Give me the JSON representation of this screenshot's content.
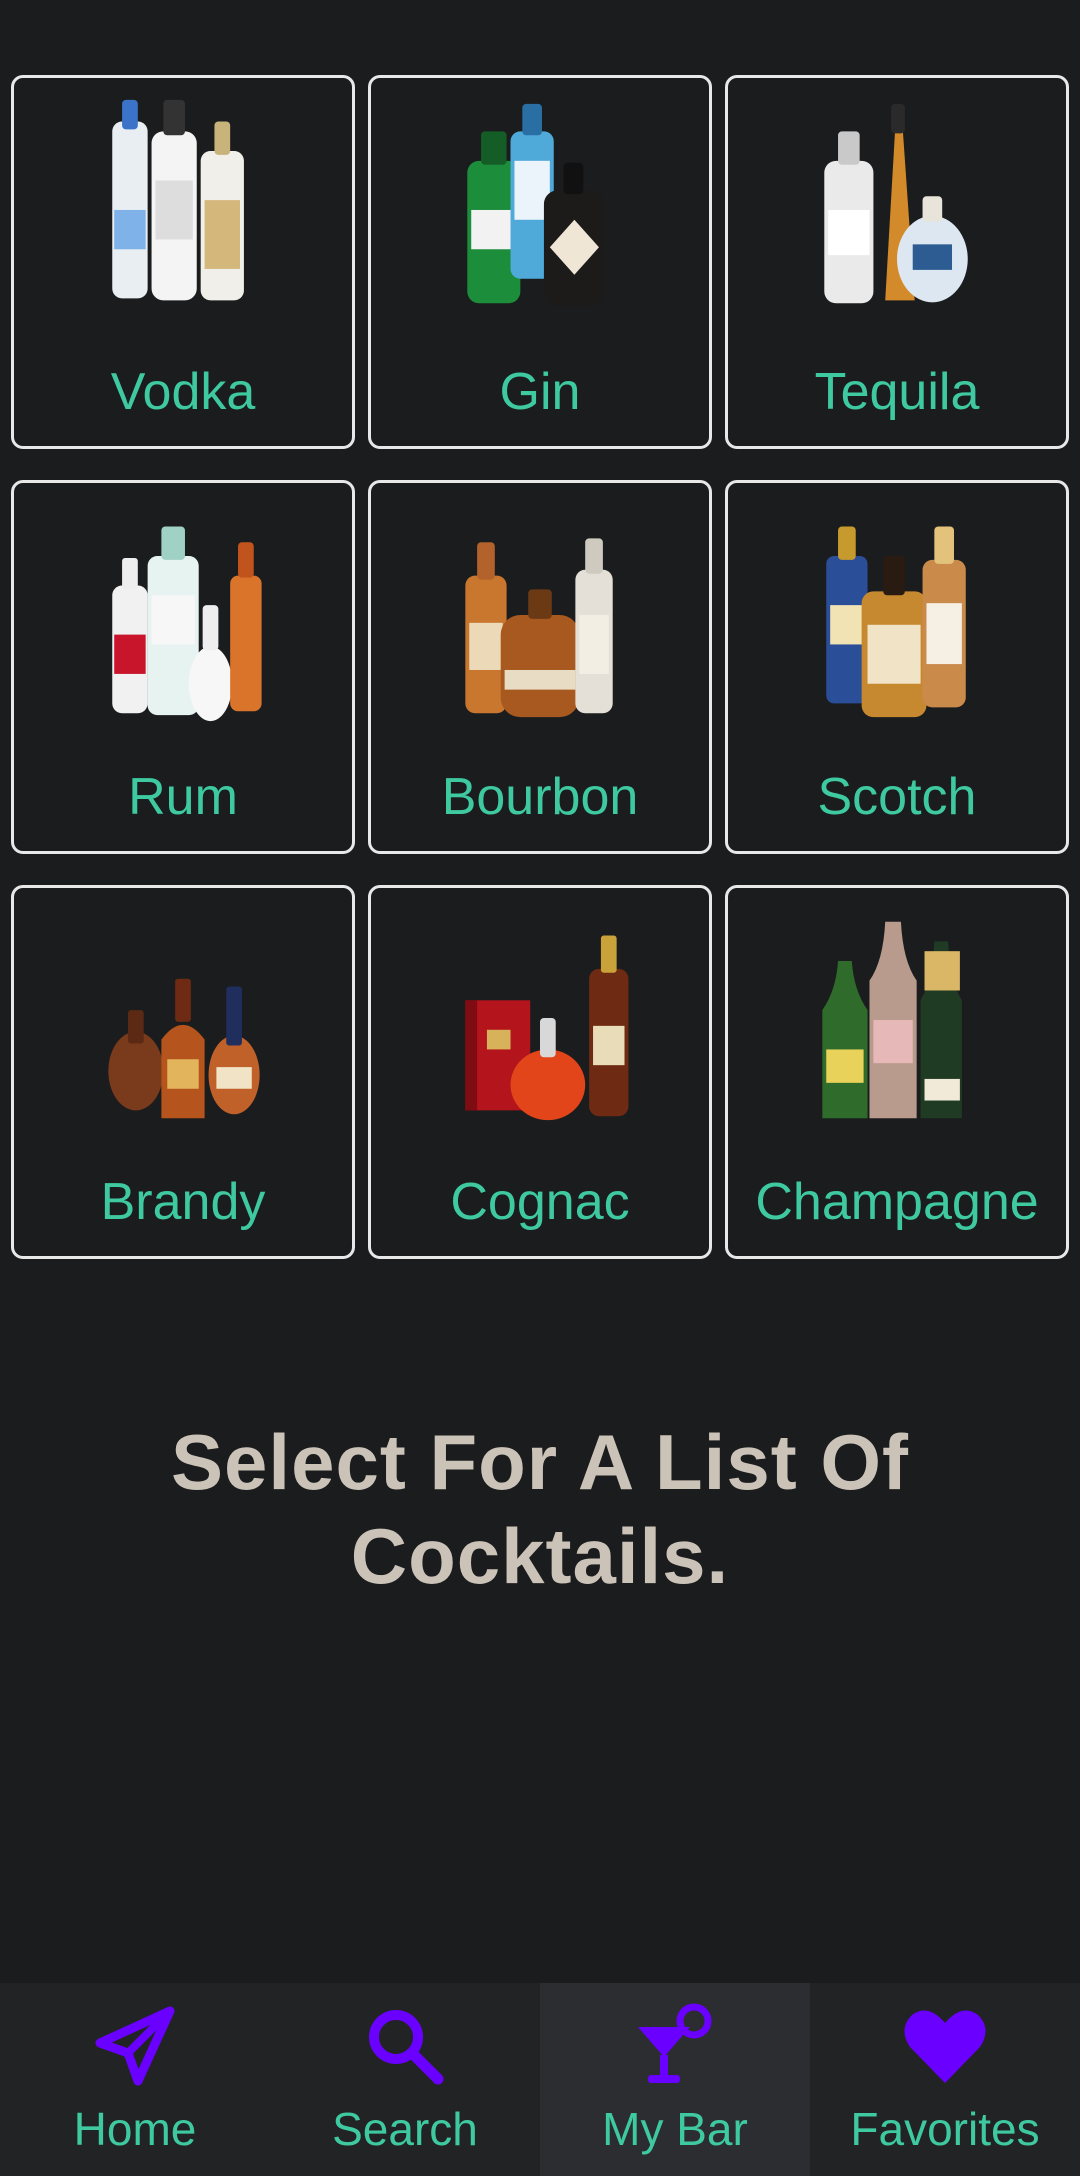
{
  "colors": {
    "background": "#1b1c1e",
    "accent_text": "#3ec9a0",
    "nav_icon": "#6a00ff",
    "prompt_text": "#cbc3b8",
    "tile_border": "#e8e8e8"
  },
  "spirits": [
    {
      "label": "Vodka",
      "icon": "vodka-bottles-image"
    },
    {
      "label": "Gin",
      "icon": "gin-bottles-image"
    },
    {
      "label": "Tequila",
      "icon": "tequila-bottles-image"
    },
    {
      "label": "Rum",
      "icon": "rum-bottles-image"
    },
    {
      "label": "Bourbon",
      "icon": "bourbon-bottles-image"
    },
    {
      "label": "Scotch",
      "icon": "scotch-bottles-image"
    },
    {
      "label": "Brandy",
      "icon": "brandy-bottles-image"
    },
    {
      "label": "Cognac",
      "icon": "cognac-bottles-image"
    },
    {
      "label": "Champagne",
      "icon": "champagne-bottles-image"
    }
  ],
  "prompt": {
    "line1": "Select For A List Of",
    "line2": "Cocktails."
  },
  "nav": {
    "items": [
      {
        "label": "Home",
        "icon": "paper-plane-icon",
        "active": false
      },
      {
        "label": "Search",
        "icon": "search-icon",
        "active": false
      },
      {
        "label": "My Bar",
        "icon": "cocktail-glass-icon",
        "active": true
      },
      {
        "label": "Favorites",
        "icon": "heart-icon",
        "active": false
      }
    ]
  }
}
